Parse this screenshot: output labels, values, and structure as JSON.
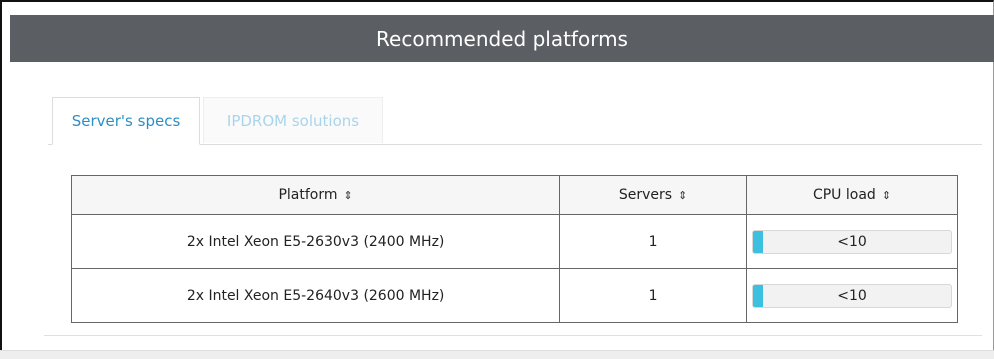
{
  "header": {
    "title": "Recommended platforms"
  },
  "tabs": [
    {
      "label": "Server's specs",
      "active": true
    },
    {
      "label": "IPDROM solutions",
      "active": false
    }
  ],
  "table": {
    "columns": [
      "Platform",
      "Servers",
      "CPU load"
    ],
    "rows": [
      {
        "platform": "2x Intel Xeon E5-2630v3 (2400 MHz)",
        "servers": "1",
        "cpu_load": "<10",
        "cpu_load_fraction": 0.05
      },
      {
        "platform": "2x Intel Xeon E5-2640v3 (2600 MHz)",
        "servers": "1",
        "cpu_load": "<10",
        "cpu_load_fraction": 0.05
      }
    ]
  },
  "icons": {
    "sort": "sort-icon"
  },
  "colors": {
    "header_bg": "#5b5e63",
    "active_tab": "#2b8fc4",
    "inactive_tab": "#a9d5ec",
    "cpu_bar": "#3dbfe0"
  }
}
